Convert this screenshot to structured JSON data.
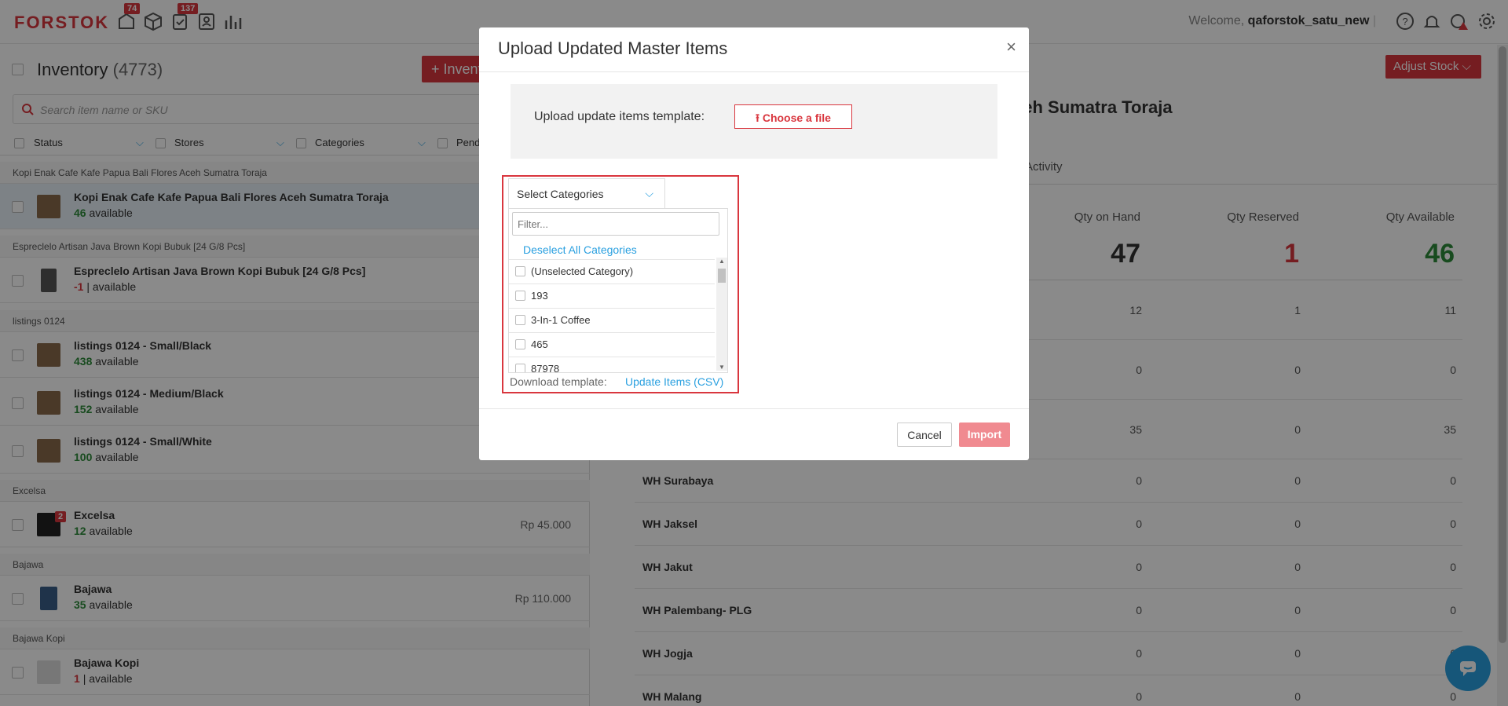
{
  "topbar": {
    "logo": "FORSTOK",
    "badge_1": "74",
    "badge_2": "137",
    "welcome_prefix": "Welcome,",
    "username": "qaforstok_satu_new"
  },
  "inventory": {
    "title": "Inventory",
    "count": "(4773)",
    "add_label": "+ Inventory",
    "search_placeholder": "Search item name or SKU",
    "filters": [
      "Status",
      "Stores",
      "Categories",
      "Pend"
    ],
    "groups": [
      {
        "label": "Kopi Enak Cafe Kafe Papua Bali Flores Aceh Sumatra Toraja"
      },
      {
        "label": "Espreclelo Artisan Java Brown Kopi Bubuk [24 G/8 Pcs]"
      },
      {
        "label": "listings 0124"
      },
      {
        "label": "Excelsa"
      },
      {
        "label": "Bajawa"
      },
      {
        "label": "Bajawa Kopi"
      }
    ],
    "items": [
      {
        "name": "Kopi Enak Cafe Kafe Papua Bali Flores Aceh Sumatra Toraja",
        "qty": "46",
        "avail": "available",
        "price": ""
      },
      {
        "name": "Espreclelo Artisan Java Brown Kopi Bubuk [24 G/8 Pcs]",
        "qty": "-1",
        "avail": "| available",
        "price": ""
      },
      {
        "name": "listings 0124 - Small/Black",
        "qty": "438",
        "avail": "available",
        "price": ""
      },
      {
        "name": "listings 0124 - Medium/Black",
        "qty": "152",
        "avail": "available",
        "price": ""
      },
      {
        "name": "listings 0124 - Small/White",
        "qty": "100",
        "avail": "available",
        "price": ""
      },
      {
        "name": "Excelsa",
        "qty": "12",
        "avail": "available",
        "price": "Rp 45.000",
        "badge": "2"
      },
      {
        "name": "Bajawa",
        "qty": "35",
        "avail": "available",
        "price": "Rp 110.000"
      },
      {
        "name": "Bajawa Kopi",
        "qty": "1",
        "avail": "| available",
        "price": ""
      }
    ]
  },
  "detail": {
    "adjust_label": "Adjust Stock",
    "title": "ceh Sumatra Toraja",
    "activity_tab": "Activity",
    "col_on_hand": "Qty on Hand",
    "col_reserved": "Qty Reserved",
    "col_available": "Qty Available",
    "total_on_hand": "47",
    "total_reserved": "1",
    "total_available": "46",
    "warehouses": [
      {
        "name": "",
        "on_hand": "12",
        "reserved": "1",
        "available": "11"
      },
      {
        "name": "",
        "on_hand": "0",
        "reserved": "0",
        "available": "0"
      },
      {
        "name": "",
        "on_hand": "35",
        "reserved": "0",
        "available": "35"
      },
      {
        "name": "WH Surabaya",
        "on_hand": "0",
        "reserved": "0",
        "available": "0"
      },
      {
        "name": "WH Jaksel",
        "on_hand": "0",
        "reserved": "0",
        "available": "0"
      },
      {
        "name": "WH Jakut",
        "on_hand": "0",
        "reserved": "0",
        "available": "0"
      },
      {
        "name": "WH Palembang- PLG",
        "on_hand": "0",
        "reserved": "0",
        "available": "0"
      },
      {
        "name": "WH Jogja",
        "on_hand": "0",
        "reserved": "0",
        "available": "0"
      },
      {
        "name": "WH Malang",
        "on_hand": "0",
        "reserved": "0",
        "available": "0"
      }
    ]
  },
  "modal": {
    "title": "Upload Updated Master Items",
    "close": "×",
    "upload_label": "Upload update items template:",
    "choose_label": "Choose a file",
    "select_categories": "Select Categories",
    "filter_placeholder": "Filter...",
    "deselect_all": "Deselect All Categories",
    "options": [
      "(Unselected Category)",
      "193",
      "3-In-1 Coffee",
      "465",
      "87978"
    ],
    "download_label": "Download template:",
    "download_link": "Update Items (CSV)",
    "cancel_label": "Cancel",
    "import_label": "Import"
  },
  "colors": {
    "accent": "#d9363e",
    "link": "#2aa0e0",
    "green": "#2e8b3a"
  }
}
